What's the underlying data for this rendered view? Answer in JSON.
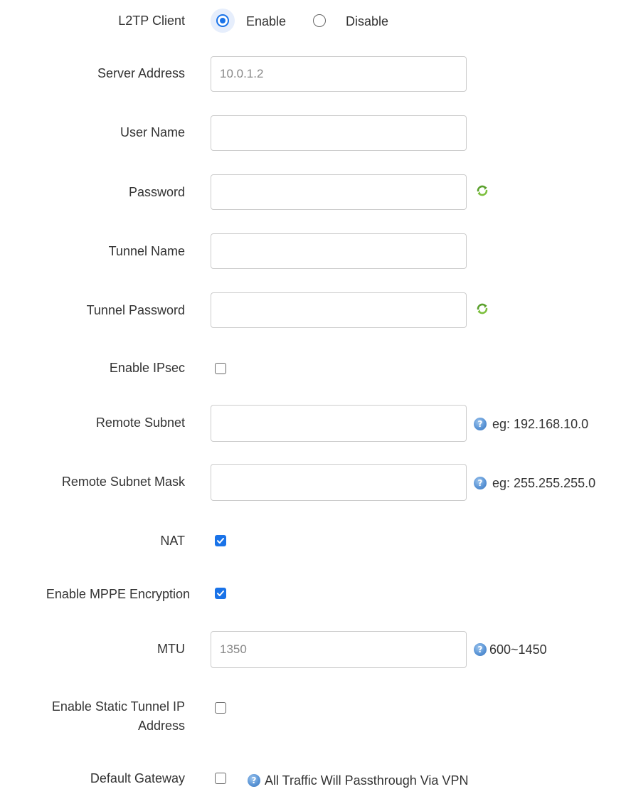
{
  "l2tp_client": {
    "label": "L2TP Client",
    "options": [
      {
        "label": "Enable",
        "selected": true
      },
      {
        "label": "Disable",
        "selected": false
      }
    ]
  },
  "server_address": {
    "label": "Server Address",
    "value": "10.0.1.2"
  },
  "user_name": {
    "label": "User Name",
    "value": ""
  },
  "password": {
    "label": "Password",
    "value": ""
  },
  "tunnel_name": {
    "label": "Tunnel Name",
    "value": ""
  },
  "tunnel_password": {
    "label": "Tunnel Password",
    "value": ""
  },
  "enable_ipsec": {
    "label": "Enable IPsec",
    "checked": false
  },
  "remote_subnet": {
    "label": "Remote Subnet",
    "value": "",
    "hint": "eg: 192.168.10.0"
  },
  "remote_subnet_mask": {
    "label": "Remote Subnet Mask",
    "value": "",
    "hint": "eg: 255.255.255.0"
  },
  "nat": {
    "label": "NAT",
    "checked": true
  },
  "mppe": {
    "label": "Enable MPPE Encryption",
    "checked": true
  },
  "mtu": {
    "label": "MTU",
    "value": "1350",
    "hint": "600~1450"
  },
  "static_tunnel_ip": {
    "label": "Enable Static Tunnel IP Address",
    "checked": false
  },
  "default_gateway": {
    "label": "Default Gateway",
    "checked": false,
    "hint": "All Traffic Will Passthrough Via VPN"
  },
  "colors": {
    "accent": "#1a73e8",
    "refresh_icon": "#5aa02c",
    "help_icon": "#5b95d6",
    "border": "#cccccc"
  },
  "icons": {
    "refresh": "refresh-icon",
    "help": "help-icon"
  }
}
